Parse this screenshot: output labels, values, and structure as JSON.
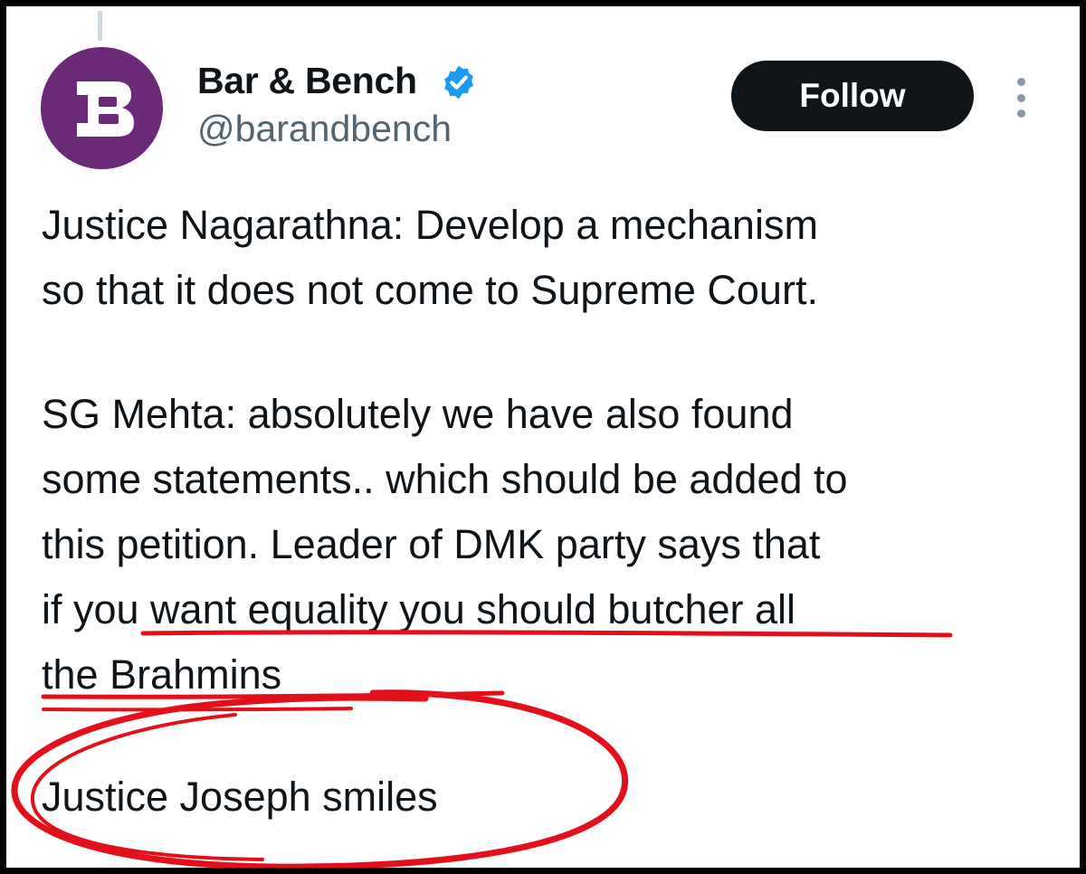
{
  "tweet": {
    "author": {
      "display_name": "Bar & Bench",
      "handle": "@barandbench",
      "verified": true,
      "avatar": {
        "icon": "bar-and-bench-logo",
        "letter": "B",
        "color": "#6a2a77"
      }
    },
    "follow_label": "Follow",
    "more_icon": "more-vertical-icon",
    "paragraphs": [
      [
        "Justice Nagarathna: Develop a mechanism",
        "so that it does not come to Supreme Court."
      ],
      [
        "SG Mehta: absolutely we have also found",
        "some statements.. which should be added to",
        "this petition. Leader of DMK party says that",
        "if you want equality you should butcher all",
        "the Brahmins"
      ],
      [
        "Justice Joseph smiles"
      ]
    ]
  },
  "annotations": {
    "color": "#e3101b",
    "underline": "red hand-drawn underline",
    "circle": "red hand-drawn ellipse around last line"
  },
  "colors": {
    "verified_badge": "#1d9bf0",
    "follow_button": "#0f1419",
    "secondary_text": "#536471"
  }
}
